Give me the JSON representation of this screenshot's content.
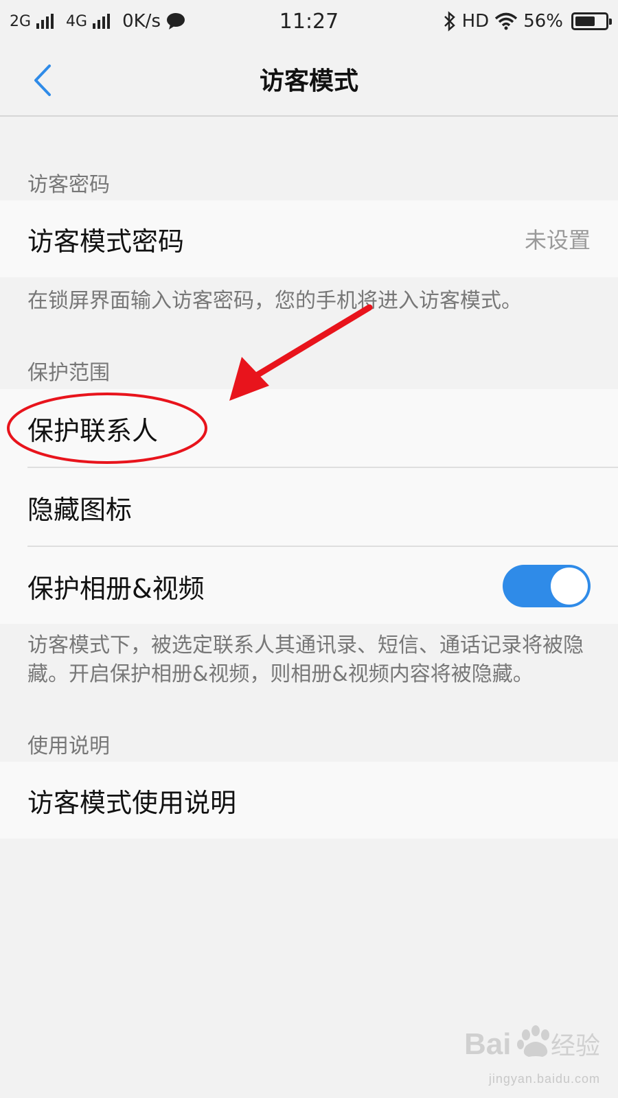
{
  "status_bar": {
    "network1": "2G",
    "network2": "4G",
    "speed": "0K/s",
    "time": "11:27",
    "hd": "HD",
    "battery": "56%"
  },
  "nav": {
    "title": "访客模式"
  },
  "password_section": {
    "label": "访客密码",
    "row_title": "访客模式密码",
    "row_value": "未设置",
    "description": "在锁屏界面输入访客密码，您的手机将进入访客模式。"
  },
  "protect_section": {
    "label": "保护范围",
    "items": [
      {
        "title": "保护联系人"
      },
      {
        "title": "隐藏图标"
      },
      {
        "title": "保护相册&视频",
        "toggle_on": true
      }
    ],
    "description": "访客模式下，被选定联系人其通讯录、短信、通话记录将被隐藏。开启保护相册&视频，则相册&视频内容将被隐藏。"
  },
  "usage_section": {
    "label": "使用说明",
    "row_title": "访客模式使用说明"
  },
  "colors": {
    "accent": "#2f8be8",
    "annotation": "#e8141c"
  },
  "watermark": {
    "brand": "Bai",
    "brand_cn": "经验",
    "url": "jingyan.baidu.com"
  }
}
